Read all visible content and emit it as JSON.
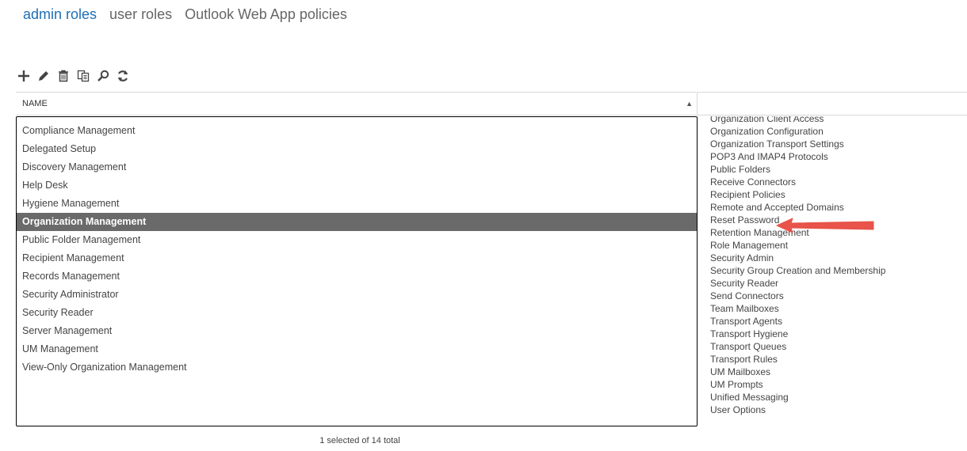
{
  "tabs": [
    "admin roles",
    "user roles",
    "Outlook Web App policies"
  ],
  "active_tab_index": 0,
  "toolbar": {
    "icons": [
      "add-icon",
      "edit-icon",
      "delete-icon",
      "copy-icon",
      "search-icon",
      "refresh-icon"
    ]
  },
  "grid": {
    "column_header": "NAME",
    "sort": "ascending",
    "rows": [
      "Compliance Management",
      "Delegated Setup",
      "Discovery Management",
      "Help Desk",
      "Hygiene Management",
      "Organization Management",
      "Public Folder Management",
      "Recipient Management",
      "Records Management",
      "Security Administrator",
      "Security Reader",
      "Server Management",
      "UM Management",
      "View-Only Organization Management"
    ],
    "selected_index": 5
  },
  "status": "1 selected of 14 total",
  "detail": {
    "roles": [
      "Organization Client Access",
      "Organization Configuration",
      "Organization Transport Settings",
      "POP3 And IMAP4 Protocols",
      "Public Folders",
      "Receive Connectors",
      "Recipient Policies",
      "Remote and Accepted Domains",
      "Reset Password",
      "Retention Management",
      "Role Management",
      "Security Admin",
      "Security Group Creation and Membership",
      "Security Reader",
      "Send Connectors",
      "Team Mailboxes",
      "Transport Agents",
      "Transport Hygiene",
      "Transport Queues",
      "Transport Rules",
      "UM Mailboxes",
      "UM Prompts",
      "Unified Messaging",
      "User Options"
    ],
    "highlighted_role": "Reset Password"
  },
  "colors": {
    "accent": "#1f6fb5",
    "selected_row": "#6a6a6a",
    "annotation_arrow": "#e8534a"
  }
}
